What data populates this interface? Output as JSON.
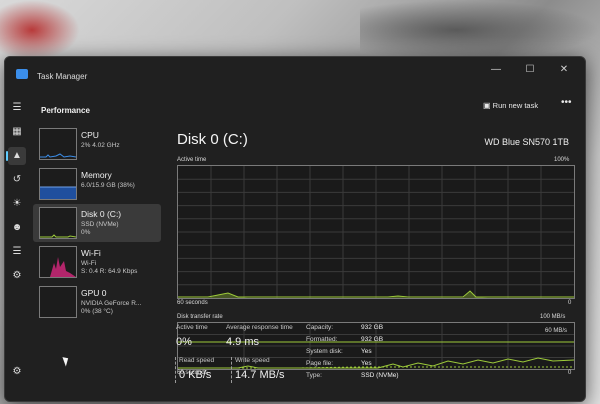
{
  "window": {
    "title": "Task Manager"
  },
  "header": {
    "section": "Performance",
    "run_new_task": "Run new task",
    "more": "•••"
  },
  "sidebar": [
    {
      "name": "CPU",
      "line1": "2%  4.02 GHz",
      "line2": ""
    },
    {
      "name": "Memory",
      "line1": "6.0/15.9 GB (38%)",
      "line2": ""
    },
    {
      "name": "Disk 0 (C:)",
      "line1": "SSD (NVMe)",
      "line2": "0%"
    },
    {
      "name": "Wi-Fi",
      "line1": "Wi-Fi",
      "line2": "S: 0.4  R: 64.9 Kbps"
    },
    {
      "name": "GPU 0",
      "line1": "NVIDIA GeForce R...",
      "line2": "0% (38 °C)"
    }
  ],
  "main": {
    "title": "Disk 0 (C:)",
    "device": "WD Blue SN570 1TB",
    "active_time_graph": {
      "label": "Active time",
      "max": "100%",
      "left_axis": "60 seconds",
      "right_axis": "0"
    },
    "transfer_graph": {
      "label": "Disk transfer rate",
      "max": "100 MB/s",
      "marker": "60 MB/s",
      "left_axis": "60 seconds",
      "right_axis": "0"
    },
    "stats": {
      "active_time_label": "Active time",
      "active_time_value": "0%",
      "avg_response_label": "Average response time",
      "avg_response_value": "4.9 ms",
      "read_speed_label": "Read speed",
      "read_speed_value": "0 KB/s",
      "write_speed_label": "Write speed",
      "write_speed_value": "14.7 MB/s"
    },
    "properties": [
      {
        "label": "Capacity:",
        "value": "932 GB"
      },
      {
        "label": "Formatted:",
        "value": "932 GB"
      },
      {
        "label": "System disk:",
        "value": "Yes"
      },
      {
        "label": "Page file:",
        "value": "Yes"
      },
      {
        "label": "Type:",
        "value": "SSD (NVMe)"
      }
    ]
  },
  "colors": {
    "disk_line": "#9dcb3a",
    "memory_fill": "#1f4f9e",
    "wifi_fill": "#b3256b",
    "accent": "#60cdff"
  },
  "icons": {
    "nav": [
      "hamburger-icon",
      "processes-icon",
      "performance-icon",
      "app-history-icon",
      "startup-icon",
      "users-icon",
      "details-icon",
      "services-icon",
      "settings-icon"
    ]
  }
}
